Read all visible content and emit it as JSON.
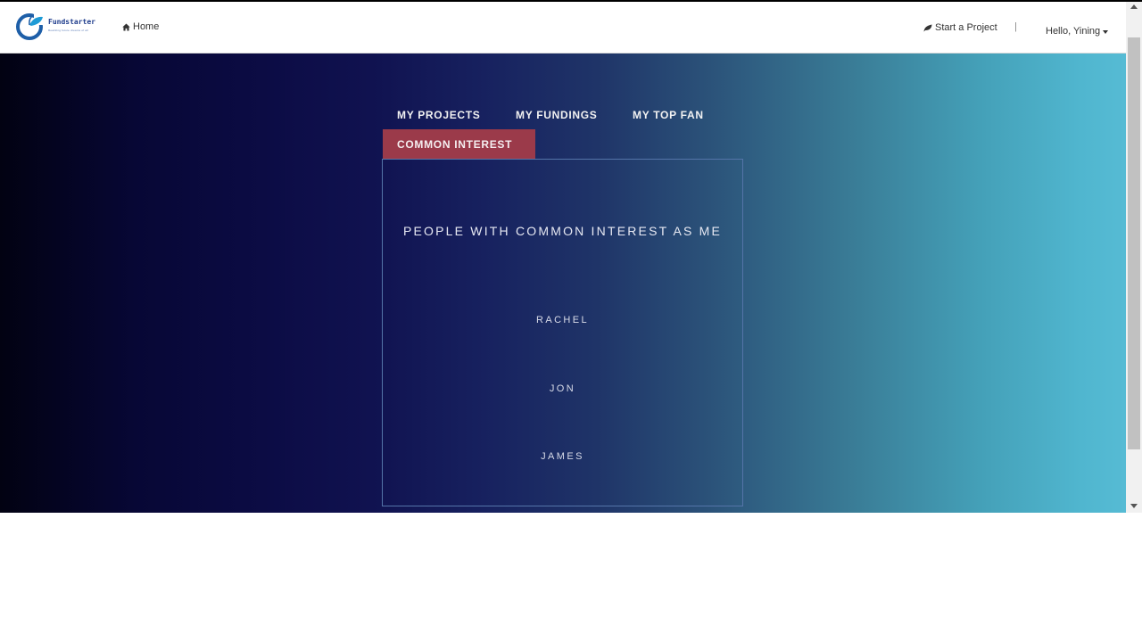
{
  "brand": {
    "name": "Fundstarter",
    "tagline": "Realizing future dreams of all",
    "accent": "#1e3c8c"
  },
  "nav": {
    "home_label": "Home",
    "home_icon": "home-icon",
    "start_label": "Start a Project",
    "start_icon": "leaf-icon",
    "separator": "|",
    "user_label": "Hello, Yining"
  },
  "tabs": [
    {
      "label": "MY PROJECTS"
    },
    {
      "label": "MY FUNDINGS"
    },
    {
      "label": "MY TOP FAN"
    },
    {
      "label": "COMMON INTEREST",
      "active": true
    }
  ],
  "panel": {
    "title": "PEOPLE WITH COMMON INTEREST AS ME",
    "people": [
      "RACHEL",
      "JON",
      "JAMES"
    ]
  },
  "colors": {
    "active_tab": "#9b3a4a",
    "panel_border": "#5474a8",
    "gradient_start": "#020212",
    "gradient_end": "#56bbd4"
  }
}
